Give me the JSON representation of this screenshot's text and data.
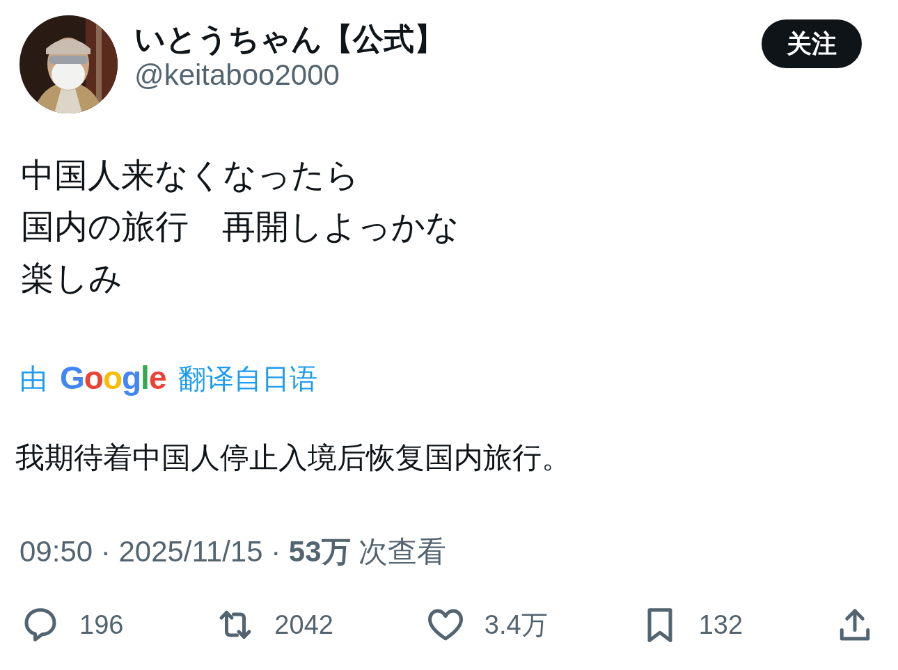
{
  "author": {
    "name": "いとうちゃん【公式】",
    "handle": "@keitaboo2000"
  },
  "follow_button": {
    "label": "关注"
  },
  "text_lines": [
    "中国人来なくなったら",
    "国内の旅行　再開しよっかな",
    "楽しみ"
  ],
  "translation": {
    "prefix": "由",
    "brand": "Google",
    "suffix": "翻译自日语",
    "text": "我期待着中国人停止入境后恢复国内旅行。"
  },
  "meta": "09:50 · 2025/11/15 · **53万** 次查看",
  "actions": [
    {
      "kind": "reply",
      "count": "196"
    },
    {
      "kind": "repost",
      "count": "2042"
    },
    {
      "kind": "like",
      "count": "3.4万"
    },
    {
      "kind": "bookmark",
      "count": "132"
    },
    {
      "kind": "share"
    }
  ]
}
